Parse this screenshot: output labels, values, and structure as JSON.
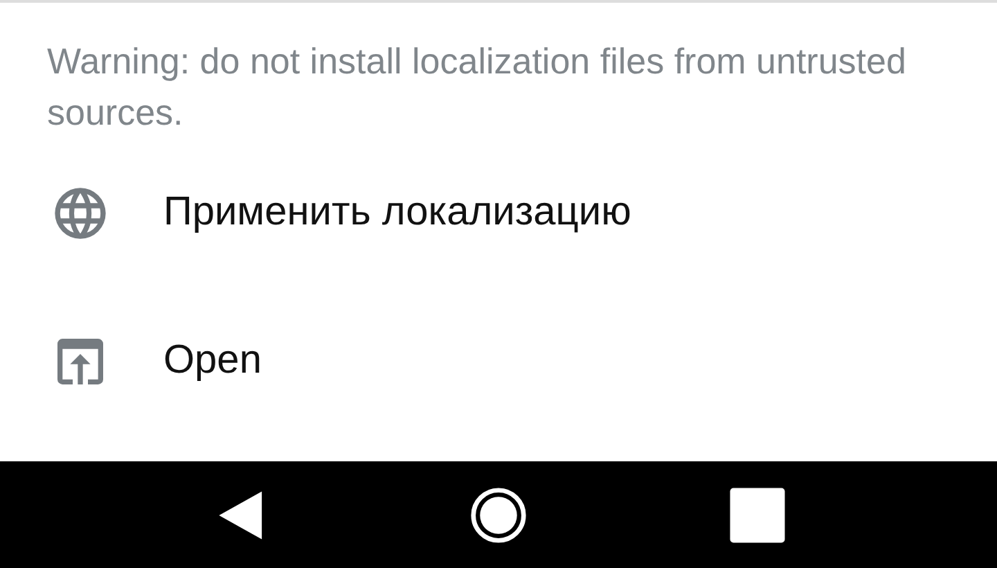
{
  "warning": "Warning: do not install localization files from untrusted sources.",
  "items": [
    {
      "kind": "globe",
      "label": "Применить локализацию"
    },
    {
      "kind": "open",
      "label": "Open"
    }
  ]
}
